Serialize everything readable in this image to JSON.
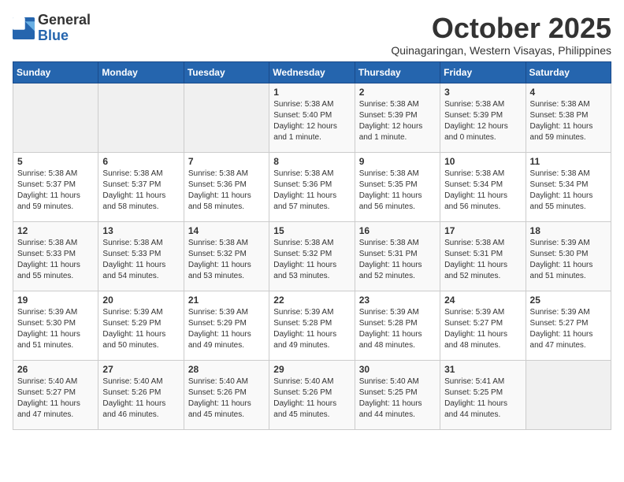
{
  "header": {
    "logo_general": "General",
    "logo_blue": "Blue",
    "month": "October 2025",
    "location": "Quinagaringan, Western Visayas, Philippines"
  },
  "weekdays": [
    "Sunday",
    "Monday",
    "Tuesday",
    "Wednesday",
    "Thursday",
    "Friday",
    "Saturday"
  ],
  "weeks": [
    [
      {
        "day": "",
        "info": ""
      },
      {
        "day": "",
        "info": ""
      },
      {
        "day": "",
        "info": ""
      },
      {
        "day": "1",
        "info": "Sunrise: 5:38 AM\nSunset: 5:40 PM\nDaylight: 12 hours\nand 1 minute."
      },
      {
        "day": "2",
        "info": "Sunrise: 5:38 AM\nSunset: 5:39 PM\nDaylight: 12 hours\nand 1 minute."
      },
      {
        "day": "3",
        "info": "Sunrise: 5:38 AM\nSunset: 5:39 PM\nDaylight: 12 hours\nand 0 minutes."
      },
      {
        "day": "4",
        "info": "Sunrise: 5:38 AM\nSunset: 5:38 PM\nDaylight: 11 hours\nand 59 minutes."
      }
    ],
    [
      {
        "day": "5",
        "info": "Sunrise: 5:38 AM\nSunset: 5:37 PM\nDaylight: 11 hours\nand 59 minutes."
      },
      {
        "day": "6",
        "info": "Sunrise: 5:38 AM\nSunset: 5:37 PM\nDaylight: 11 hours\nand 58 minutes."
      },
      {
        "day": "7",
        "info": "Sunrise: 5:38 AM\nSunset: 5:36 PM\nDaylight: 11 hours\nand 58 minutes."
      },
      {
        "day": "8",
        "info": "Sunrise: 5:38 AM\nSunset: 5:36 PM\nDaylight: 11 hours\nand 57 minutes."
      },
      {
        "day": "9",
        "info": "Sunrise: 5:38 AM\nSunset: 5:35 PM\nDaylight: 11 hours\nand 56 minutes."
      },
      {
        "day": "10",
        "info": "Sunrise: 5:38 AM\nSunset: 5:34 PM\nDaylight: 11 hours\nand 56 minutes."
      },
      {
        "day": "11",
        "info": "Sunrise: 5:38 AM\nSunset: 5:34 PM\nDaylight: 11 hours\nand 55 minutes."
      }
    ],
    [
      {
        "day": "12",
        "info": "Sunrise: 5:38 AM\nSunset: 5:33 PM\nDaylight: 11 hours\nand 55 minutes."
      },
      {
        "day": "13",
        "info": "Sunrise: 5:38 AM\nSunset: 5:33 PM\nDaylight: 11 hours\nand 54 minutes."
      },
      {
        "day": "14",
        "info": "Sunrise: 5:38 AM\nSunset: 5:32 PM\nDaylight: 11 hours\nand 53 minutes."
      },
      {
        "day": "15",
        "info": "Sunrise: 5:38 AM\nSunset: 5:32 PM\nDaylight: 11 hours\nand 53 minutes."
      },
      {
        "day": "16",
        "info": "Sunrise: 5:38 AM\nSunset: 5:31 PM\nDaylight: 11 hours\nand 52 minutes."
      },
      {
        "day": "17",
        "info": "Sunrise: 5:38 AM\nSunset: 5:31 PM\nDaylight: 11 hours\nand 52 minutes."
      },
      {
        "day": "18",
        "info": "Sunrise: 5:39 AM\nSunset: 5:30 PM\nDaylight: 11 hours\nand 51 minutes."
      }
    ],
    [
      {
        "day": "19",
        "info": "Sunrise: 5:39 AM\nSunset: 5:30 PM\nDaylight: 11 hours\nand 51 minutes."
      },
      {
        "day": "20",
        "info": "Sunrise: 5:39 AM\nSunset: 5:29 PM\nDaylight: 11 hours\nand 50 minutes."
      },
      {
        "day": "21",
        "info": "Sunrise: 5:39 AM\nSunset: 5:29 PM\nDaylight: 11 hours\nand 49 minutes."
      },
      {
        "day": "22",
        "info": "Sunrise: 5:39 AM\nSunset: 5:28 PM\nDaylight: 11 hours\nand 49 minutes."
      },
      {
        "day": "23",
        "info": "Sunrise: 5:39 AM\nSunset: 5:28 PM\nDaylight: 11 hours\nand 48 minutes."
      },
      {
        "day": "24",
        "info": "Sunrise: 5:39 AM\nSunset: 5:27 PM\nDaylight: 11 hours\nand 48 minutes."
      },
      {
        "day": "25",
        "info": "Sunrise: 5:39 AM\nSunset: 5:27 PM\nDaylight: 11 hours\nand 47 minutes."
      }
    ],
    [
      {
        "day": "26",
        "info": "Sunrise: 5:40 AM\nSunset: 5:27 PM\nDaylight: 11 hours\nand 47 minutes."
      },
      {
        "day": "27",
        "info": "Sunrise: 5:40 AM\nSunset: 5:26 PM\nDaylight: 11 hours\nand 46 minutes."
      },
      {
        "day": "28",
        "info": "Sunrise: 5:40 AM\nSunset: 5:26 PM\nDaylight: 11 hours\nand 45 minutes."
      },
      {
        "day": "29",
        "info": "Sunrise: 5:40 AM\nSunset: 5:26 PM\nDaylight: 11 hours\nand 45 minutes."
      },
      {
        "day": "30",
        "info": "Sunrise: 5:40 AM\nSunset: 5:25 PM\nDaylight: 11 hours\nand 44 minutes."
      },
      {
        "day": "31",
        "info": "Sunrise: 5:41 AM\nSunset: 5:25 PM\nDaylight: 11 hours\nand 44 minutes."
      },
      {
        "day": "",
        "info": ""
      }
    ]
  ]
}
